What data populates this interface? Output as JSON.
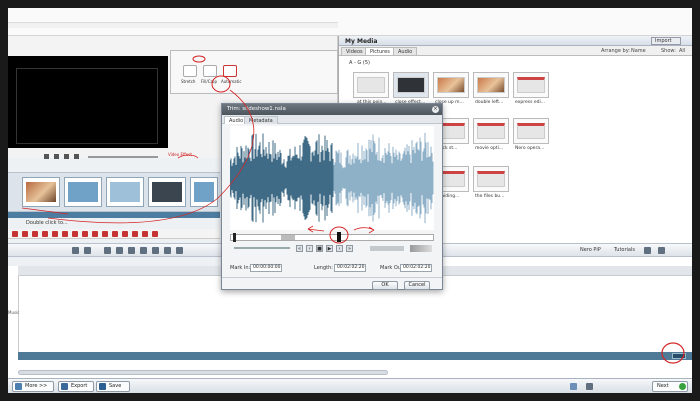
{
  "media": {
    "title": "My Media",
    "import_label": "Import",
    "tabs": [
      "Videos",
      "Pictures",
      "Audio"
    ],
    "arrange_label": "Arrange by:",
    "arrange_value": "Name",
    "show_label": "Show:",
    "show_value": "All",
    "group_header": "A - G (5)",
    "items": [
      {
        "caption": "at this poin..."
      },
      {
        "caption": "close effect..."
      },
      {
        "caption": "close up m..."
      },
      {
        "caption": "double left..."
      },
      {
        "caption": "express edi..."
      },
      {
        "caption": "...ick st..."
      },
      {
        "caption": "movie opti..."
      },
      {
        "caption": "Nero opera..."
      },
      {
        "caption": "...aiding..."
      },
      {
        "caption": "the files bu..."
      }
    ]
  },
  "thumb_panel": {
    "tiles": [
      "Stretch",
      "Fill/Crop",
      "Automatic"
    ]
  },
  "preview": {
    "sub_label": "Video Effect"
  },
  "filmstrip": {
    "caption": "Double click to..."
  },
  "toolbar": {
    "right_items": [
      "Nero PiP",
      "Tutorials"
    ]
  },
  "timeline": {
    "track_label": "Music"
  },
  "dialog": {
    "title": "Trim: slideshow1.nsla",
    "tabs": [
      "Audio",
      "Metadata"
    ],
    "mark_in_label": "Mark In:",
    "mark_in_value": "00:00:00:00",
    "length_label": "Length:",
    "length_value": "00:02:02:20",
    "mark_out_label": "Mark Out:",
    "mark_out_value": "00:02:02:20",
    "ok_label": "OK",
    "cancel_label": "Cancel"
  },
  "bottom": {
    "buttons": [
      "More >>",
      "Export",
      "Save"
    ],
    "next_label": "Next"
  },
  "colors": {
    "wave_dark": "#3f6b86",
    "wave_light": "#8fb1c8",
    "annotation_red": "#d42424",
    "accent_blue": "#4e7a98"
  }
}
